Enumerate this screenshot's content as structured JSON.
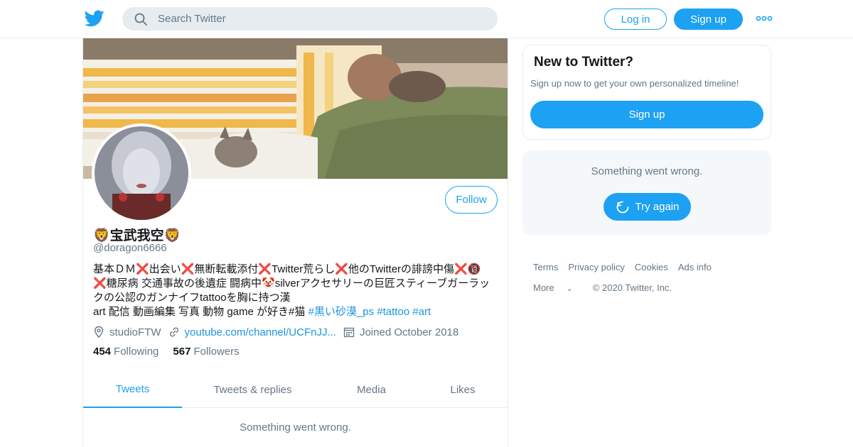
{
  "header": {
    "search_placeholder": "Search Twitter",
    "login_label": "Log in",
    "signup_label": "Sign up"
  },
  "profile": {
    "follow_label": "Follow",
    "display_name": "🦁宝武我空🦁",
    "handle": "@doragon6666",
    "bio": {
      "line1": "基本ＤＭ❌出会い❌無断転載添付❌Twitter荒らし❌他のTwitterの誹謗中傷❌🔞",
      "line2": "❌糖尿病 交通事故の後遺症 闘病中🤡silverアクセサリーの巨匠スティーブガーラッ",
      "line3": "クの公認のガンナイフtattooを胸に持つ漢",
      "line4_text": "art 配信 動画編集 写真 動物 game が好き#猫 ",
      "hashtag1": "#黒い砂漠_ps",
      "hashtag2": "#tattoo",
      "hashtag3": "#art"
    },
    "location": "studioFTW",
    "url": "youtube.com/channel/UCFnJJ...",
    "joined": "Joined October 2018",
    "following_count": "454",
    "following_label": "Following",
    "followers_count": "567",
    "followers_label": "Followers"
  },
  "tabs": [
    {
      "label": "Tweets",
      "active": true
    },
    {
      "label": "Tweets & replies",
      "active": false
    },
    {
      "label": "Media",
      "active": false
    },
    {
      "label": "Likes",
      "active": false
    }
  ],
  "timeline": {
    "error_text": "Something went wrong."
  },
  "sidebar": {
    "new_title": "New to Twitter?",
    "new_subtitle": "Sign up now to get your own personalized timeline!",
    "signup_label": "Sign up",
    "error_text": "Something went wrong.",
    "retry_label": "Try again"
  },
  "footer": {
    "links": [
      "Terms",
      "Privacy policy",
      "Cookies",
      "Ads info"
    ],
    "more_label": "More",
    "copyright": "© 2020 Twitter, Inc."
  },
  "colors": {
    "accent": "#1da1f2",
    "link": "#1b95e0",
    "muted_text": "#657786",
    "border": "#e6ecf0"
  },
  "icons": [
    "twitter-bird-icon",
    "search-icon",
    "more-dots-icon",
    "location-icon",
    "link-icon",
    "calendar-icon",
    "refresh-icon",
    "chevron-down-icon"
  ]
}
